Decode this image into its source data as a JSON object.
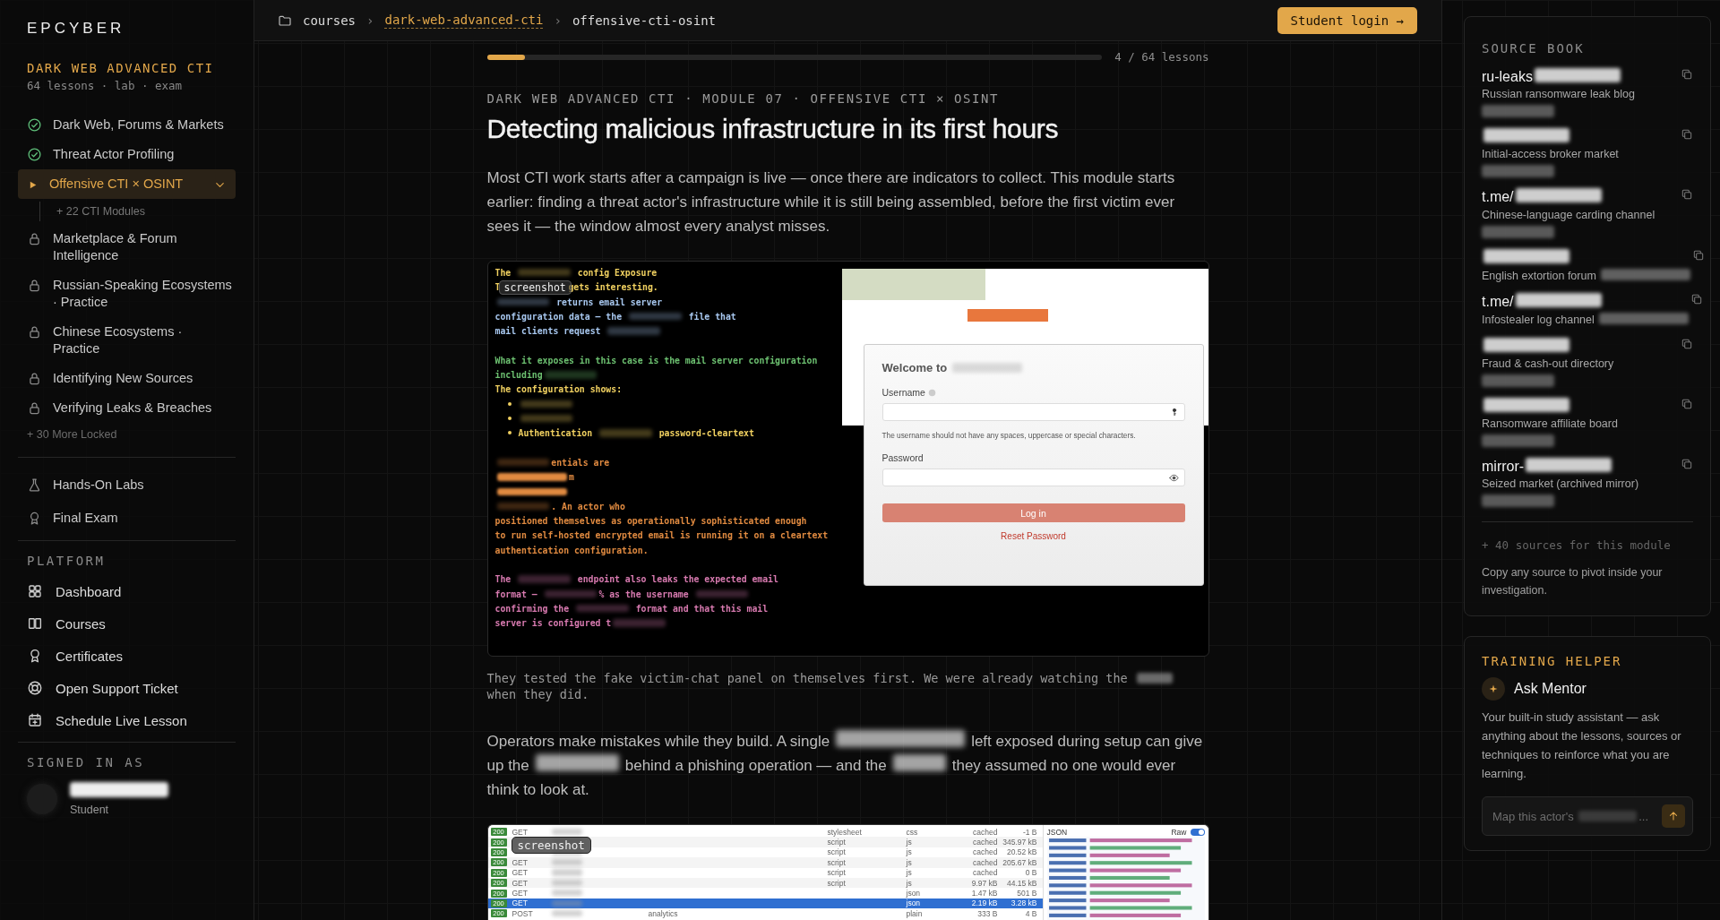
{
  "brand": "EPCYBER",
  "course": {
    "title": "DARK WEB ADVANCED CTI",
    "meta": "64 lessons · lab · exam"
  },
  "lessons": [
    {
      "kind": "done",
      "label": "Dark Web, Forums & Markets",
      "selected": false
    },
    {
      "kind": "done",
      "label": "Threat Actor Profiling",
      "selected": false
    },
    {
      "kind": "current",
      "label": "Offensive CTI × OSINT",
      "selected": true,
      "expanded": true,
      "children": [
        {
          "label": "+ 22 CTI Modules"
        }
      ]
    },
    {
      "kind": "locked",
      "label": "Marketplace & Forum Intelligence",
      "selected": false
    },
    {
      "kind": "locked",
      "label": "Russian-Speaking Ecosystems · Practice",
      "selected": false
    },
    {
      "kind": "locked",
      "label": "Chinese Ecosystems · Practice",
      "selected": false
    },
    {
      "kind": "locked",
      "label": "Identifying New Sources",
      "selected": false
    },
    {
      "kind": "locked",
      "label": "Verifying Leaks & Breaches",
      "selected": false
    }
  ],
  "more_locked": "+ 30 More Locked",
  "extras": [
    {
      "kind": "lab",
      "label": "Hands-On Labs"
    },
    {
      "kind": "exam",
      "label": "Final Exam"
    }
  ],
  "platform": {
    "heading": "PLATFORM",
    "items": [
      {
        "kind": "dashboard",
        "label": "Dashboard"
      },
      {
        "kind": "courses",
        "label": "Courses"
      },
      {
        "kind": "certificates",
        "label": "Certificates"
      },
      {
        "kind": "support",
        "label": "Open Support Ticket"
      },
      {
        "kind": "schedule",
        "label": "Schedule Live Lesson"
      }
    ]
  },
  "account": {
    "heading": "SIGNED IN AS",
    "role": "Student"
  },
  "breadcrumb": {
    "separator": "›",
    "items": [
      {
        "kind": "root",
        "label": "courses"
      },
      {
        "kind": "link",
        "label": "dark-web-advanced-cti"
      },
      {
        "kind": "current",
        "label": "offensive-cti-osint"
      }
    ]
  },
  "login_button": "Student login →",
  "progress": {
    "level": 0.0625,
    "reading": "4 / 64 lessons"
  },
  "eyebrow": "DARK WEB ADVANCED CTI · MODULE 07 · OFFENSIVE CTI × OSINT",
  "title": "Detecting malicious infrastructure in its first hours",
  "content": [
    {
      "kind": "paragraph",
      "segments": [
        "Most CTI work starts after a campaign is live — once there are indicators to collect. This module starts earlier: finding a threat actor's infrastructure while it is still being assembled, before the first victim ever sees it — the window almost every analyst misses."
      ]
    },
    {
      "kind": "terminal_shot",
      "badge": "screenshot",
      "lines": [
        {
          "kind": "text",
          "color": "#f0d060",
          "segments": [
            "The ",
            {
              "kind": "redacted"
            },
            " config Exposure"
          ]
        },
        {
          "kind": "text",
          "color": "#f0d060",
          "segments": [
            "T",
            {
              "kind": "covered"
            },
            "gets interesting."
          ]
        },
        {
          "kind": "text",
          "color": "#a8c8f0",
          "segments": [
            {
              "kind": "redacted"
            },
            " returns email server"
          ]
        },
        {
          "kind": "text",
          "color": "#a8c8f0",
          "segments": [
            "configuration data — the ",
            {
              "kind": "redacted"
            },
            " file that"
          ]
        },
        {
          "kind": "text",
          "color": "#a8c8f0",
          "segments": [
            "mail clients request ",
            {
              "kind": "redacted"
            }
          ]
        },
        {
          "kind": "gap"
        },
        {
          "kind": "text",
          "color": "#6cc070",
          "segments": [
            "What it exposes in this case is the mail server configuration"
          ]
        },
        {
          "kind": "text",
          "color": "#6cc070",
          "segments": [
            "including",
            {
              "kind": "redacted"
            }
          ]
        },
        {
          "kind": "text",
          "color": "#f0d060",
          "segments": [
            "The configuration shows:"
          ]
        },
        {
          "kind": "bullet",
          "color": "#f0d060",
          "segments": [
            {
              "kind": "redacted"
            }
          ]
        },
        {
          "kind": "bullet",
          "color": "#f0d060",
          "segments": [
            {
              "kind": "redacted"
            }
          ]
        },
        {
          "kind": "bullet",
          "color": "#f0d060",
          "segments": [
            "Authentication ",
            {
              "kind": "redacted"
            },
            " password-cleartext"
          ]
        },
        {
          "kind": "gap"
        },
        {
          "kind": "text",
          "color": "#e08a40",
          "segments": [
            {
              "kind": "redacted"
            },
            "entials are"
          ]
        },
        {
          "kind": "text",
          "color": "#e08a40",
          "segments": [
            {
              "kind": "redacted"
            },
            "m"
          ]
        },
        {
          "kind": "text",
          "color": "#e08a40",
          "segments": [
            {
              "kind": "redacted"
            }
          ]
        },
        {
          "kind": "text",
          "color": "#e08a40",
          "segments": [
            {
              "kind": "redacted"
            },
            ". An actor who"
          ]
        },
        {
          "kind": "text",
          "color": "#e08a40",
          "segments": [
            "positioned themselves as operationally sophisticated enough"
          ]
        },
        {
          "kind": "text",
          "color": "#e08a40",
          "segments": [
            "to run self-hosted encrypted email is running it on a cleartext"
          ]
        },
        {
          "kind": "text",
          "color": "#e08a40",
          "segments": [
            "authentication configuration."
          ]
        },
        {
          "kind": "gap"
        },
        {
          "kind": "text",
          "color": "#d87ab0",
          "segments": [
            "The ",
            {
              "kind": "redacted"
            },
            " endpoint also leaks the expected email"
          ]
        },
        {
          "kind": "text",
          "color": "#d87ab0",
          "segments": [
            "format — ",
            {
              "kind": "redacted"
            },
            "% as the username ",
            {
              "kind": "redacted"
            }
          ]
        },
        {
          "kind": "text",
          "color": "#d87ab0",
          "segments": [
            "confirming the ",
            {
              "kind": "redacted"
            },
            " format and that this mail"
          ]
        },
        {
          "kind": "text",
          "color": "#d87ab0",
          "segments": [
            "server is configured t",
            {
              "kind": "redacted"
            }
          ]
        }
      ],
      "login": {
        "welcome": "Welcome to",
        "username_label": "Username",
        "hint": "The username should not have any spaces, uppercase or special characters.",
        "password_label": "Password",
        "button": "Log in",
        "link": "Reset Password"
      }
    },
    {
      "kind": "caption",
      "segments": [
        "They tested the fake victim-chat panel on themselves first. We were already watching the ",
        {
          "kind": "redacted"
        },
        " when they did."
      ]
    },
    {
      "kind": "paragraph",
      "segments": [
        "Operators make mistakes while they build. A single ",
        {
          "kind": "redacted"
        },
        " left exposed during setup can give up the ",
        {
          "kind": "redacted"
        },
        " behind a phishing operation — and the ",
        {
          "kind": "redacted"
        },
        " they assumed no one would ever think to look at."
      ]
    },
    {
      "kind": "network_shot",
      "badge": "screenshot",
      "rows": [
        {
          "status": "200",
          "method": "GET",
          "type": "stylesheet",
          "format": "css",
          "transferred": "cached",
          "size": "-1 B",
          "selected": false
        },
        {
          "status": "200",
          "type": "script",
          "format": "js",
          "transferred": "cached",
          "size": "345.97 kB",
          "selected": false
        },
        {
          "status": "200",
          "type": "script",
          "format": "js",
          "transferred": "cached",
          "size": "20.52 kB",
          "selected": false
        },
        {
          "status": "200",
          "method": "GET",
          "type": "script",
          "format": "js",
          "transferred": "cached",
          "size": "205.67 kB",
          "selected": false
        },
        {
          "status": "200",
          "method": "GET",
          "type": "script",
          "format": "js",
          "transferred": "cached",
          "size": "0 B",
          "selected": false
        },
        {
          "status": "200",
          "method": "GET",
          "type": "script",
          "format": "js",
          "transferred": "9.97 kB",
          "size": "44.15 kB",
          "selected": false
        },
        {
          "status": "200",
          "method": "GET",
          "format": "json",
          "transferred": "1.47 kB",
          "size": "501 B",
          "selected": false
        },
        {
          "status": "200",
          "method": "GET",
          "format": "json",
          "transferred": "2.19 kB",
          "size": "3.28 kB",
          "selected": true
        },
        {
          "status": "200",
          "method": "POST",
          "initiator": "analytics",
          "format": "plain",
          "transferred": "333 B",
          "size": "4 B",
          "selected": false
        }
      ],
      "json_title": "JSON",
      "raw_label": "Raw",
      "raw_on": true
    }
  ],
  "source_book": {
    "heading": "SOURCE BOOK",
    "sources": [
      {
        "name": [
          "ru-leaks",
          {
            "kind": "redacted"
          }
        ],
        "description": [
          "Russian ransomware leak blog"
        ],
        "detail": {
          "kind": "redacted"
        }
      },
      {
        "name": [
          {
            "kind": "redacted"
          }
        ],
        "description": [
          "Initial-access broker market"
        ],
        "detail": {
          "kind": "redacted"
        }
      },
      {
        "name": [
          "t.me/",
          {
            "kind": "redacted"
          }
        ],
        "description": [
          "Chinese-language carding channel"
        ],
        "detail": {
          "kind": "redacted"
        }
      },
      {
        "name": [
          {
            "kind": "redacted"
          }
        ],
        "description": [
          "English extortion forum ",
          {
            "kind": "redacted"
          }
        ]
      },
      {
        "name": [
          "t.me/",
          {
            "kind": "redacted"
          }
        ],
        "description": [
          "Infostealer log channel ",
          {
            "kind": "redacted"
          }
        ]
      },
      {
        "name": [
          {
            "kind": "redacted"
          }
        ],
        "description": [
          "Fraud & cash-out directory"
        ],
        "detail": {
          "kind": "redacted"
        }
      },
      {
        "name": [
          {
            "kind": "redacted"
          }
        ],
        "description": [
          "Ransomware affiliate board"
        ],
        "detail": {
          "kind": "redacted"
        }
      },
      {
        "name": [
          "mirror-",
          {
            "kind": "redacted"
          }
        ],
        "description": [
          "Seized market (archived mirror)"
        ],
        "detail": {
          "kind": "redacted"
        }
      }
    ],
    "more": "+ 40 sources for this module",
    "note": "Copy any source to pivot inside your investigation."
  },
  "helper": {
    "heading": "TRAINING HELPER",
    "title": "Ask Mentor",
    "text": "Your built-in study assistant — ask anything about the lessons, sources or techniques to reinforce what you are learning.",
    "placeholder": [
      "Map this actor's ",
      {
        "kind": "redacted"
      },
      "..."
    ]
  }
}
